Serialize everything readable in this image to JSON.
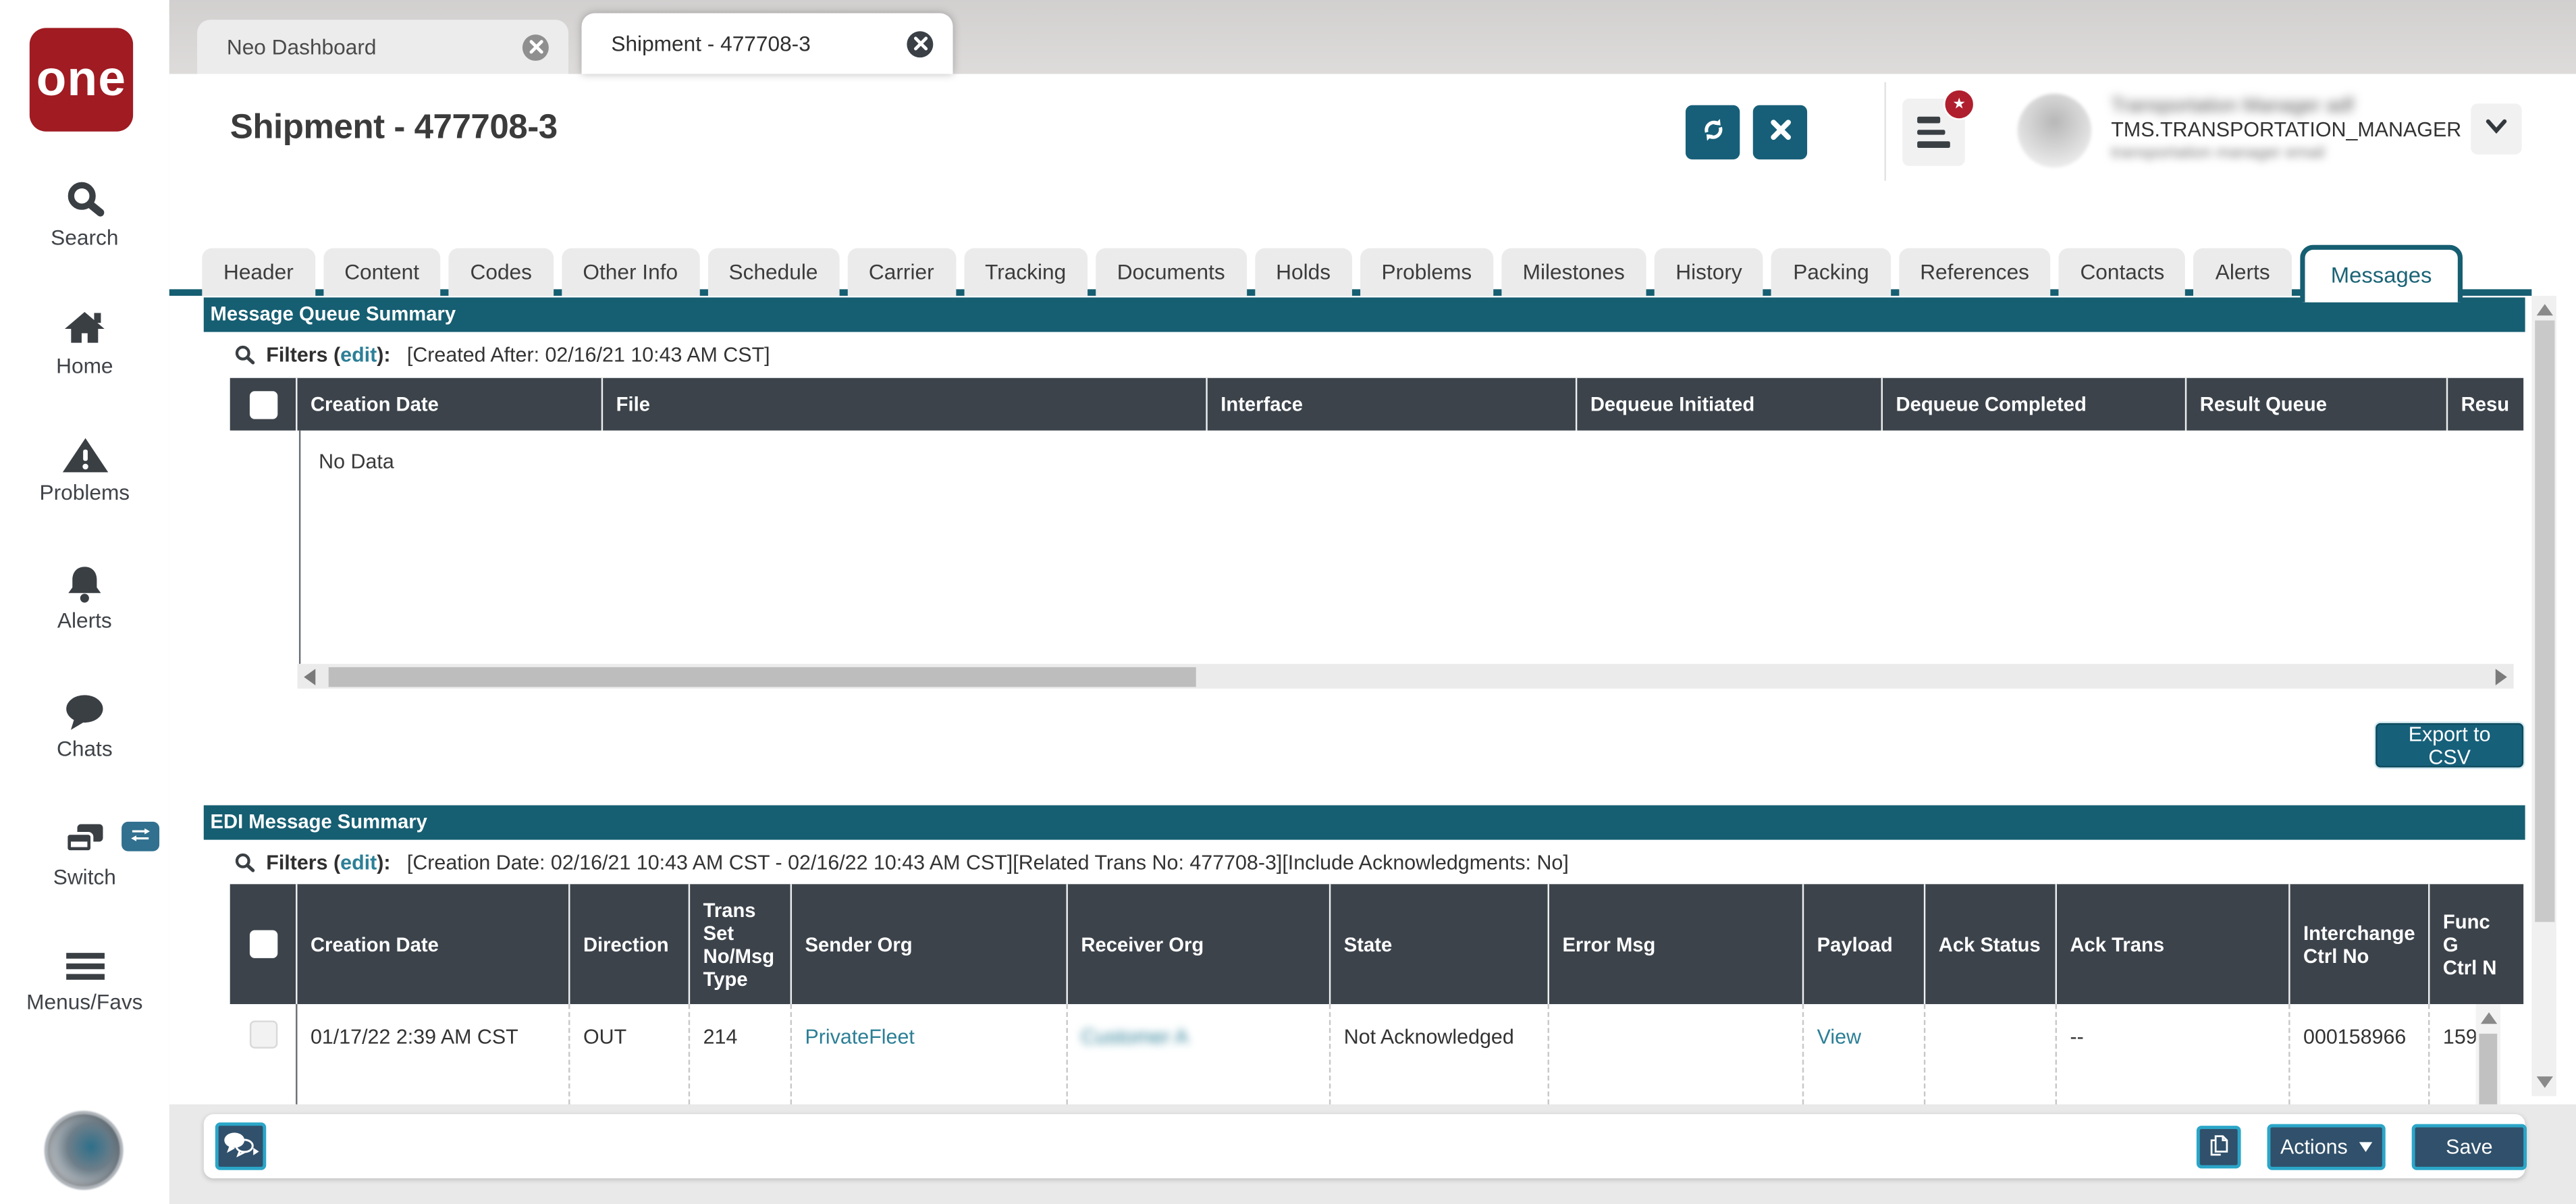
{
  "colors": {
    "teal": "#165e72",
    "table_header": "#3c434b",
    "logo_red": "#a01b22",
    "badge_red": "#b01f2e",
    "link_teal": "#2c7f96",
    "footer_button": "#30506b",
    "footer_button_border": "#2ba6c8"
  },
  "sidebar": {
    "logo_text": "one",
    "items": [
      {
        "icon": "search-icon",
        "label": "Search"
      },
      {
        "icon": "home-icon",
        "label": "Home"
      },
      {
        "icon": "problems-icon",
        "label": "Problems"
      },
      {
        "icon": "alerts-icon",
        "label": "Alerts"
      },
      {
        "icon": "chats-icon",
        "label": "Chats"
      },
      {
        "icon": "switch-icon",
        "label": "Switch"
      },
      {
        "icon": "menus-icon",
        "label": "Menus/Favs"
      }
    ]
  },
  "browser_tabs": {
    "inactive": "Neo Dashboard",
    "active": "Shipment - 477708-3"
  },
  "header": {
    "title": "Shipment - 477708-3",
    "user": {
      "name_masked": "Transportation Manager adf",
      "role": "TMS.TRANSPORTATION_MANAGER",
      "org_masked": "transportation manager email"
    }
  },
  "detail_tabs": {
    "items": [
      "Header",
      "Content",
      "Codes",
      "Other Info",
      "Schedule",
      "Carrier",
      "Tracking",
      "Documents",
      "Holds",
      "Problems",
      "Milestones",
      "History",
      "Packing",
      "References",
      "Contacts",
      "Alerts",
      "Messages"
    ],
    "active": "Messages"
  },
  "message_queue": {
    "title": "Message Queue Summary",
    "filters_prefix": "Filters (",
    "edit_link": "edit",
    "filters_suffix": "):",
    "filters_value": "[Created After: 02/16/21 10:43 AM CST]",
    "columns": [
      "Creation Date",
      "File",
      "Interface",
      "Dequeue Initiated",
      "Dequeue Completed",
      "Result Queue",
      "Resu"
    ],
    "empty_text": "No Data",
    "export_label": "Export to CSV"
  },
  "edi": {
    "title": "EDI Message Summary",
    "filters_prefix": "Filters (",
    "edit_link": "edit",
    "filters_suffix": "):",
    "filters_value": "[Creation Date: 02/16/21 10:43 AM CST - 02/16/22 10:43 AM CST][Related Trans No: 477708-3][Include Acknowledgments: No]",
    "columns": [
      "Creation Date",
      "Direction",
      "Trans\nSet\nNo/Msg\nType",
      "Sender Org",
      "Receiver Org",
      "State",
      "Error Msg",
      "Payload",
      "Ack Status",
      "Ack Trans",
      "Interchange Ctrl No",
      "Func G\nCtrl N"
    ],
    "row": {
      "creation_date": "01/17/22 2:39 AM CST",
      "direction": "OUT",
      "trans_set_no": "214",
      "sender_org": "PrivateFleet",
      "receiver_org_masked": "Customer A",
      "state": "Not Acknowledged",
      "error_msg": "",
      "payload_link": "View",
      "ack_status": "",
      "ack_trans": "--",
      "interchange_ctrl_no": "000158966",
      "func_ctrl_no": "159"
    }
  },
  "footer": {
    "actions_label": "Actions",
    "save_label": "Save"
  }
}
